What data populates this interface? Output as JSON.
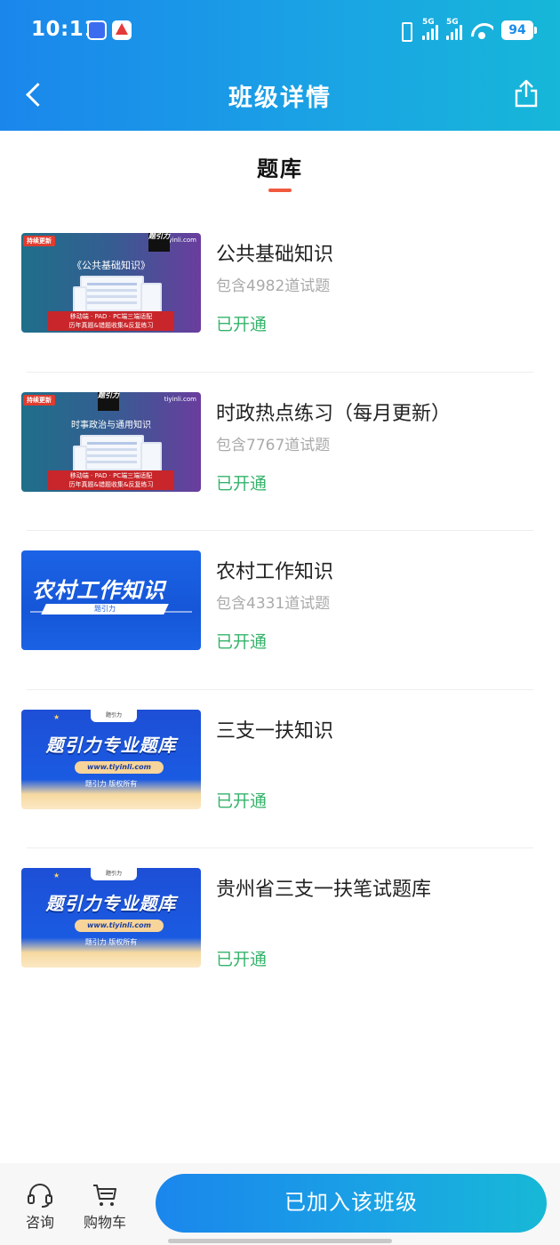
{
  "status_bar": {
    "time": "10:11",
    "battery": "94",
    "network_labels": [
      "5G",
      "5G"
    ]
  },
  "nav": {
    "title": "班级详情"
  },
  "tab": {
    "label": "题库",
    "underline_color": "#f05a3e"
  },
  "items": [
    {
      "title": "公共基础知识",
      "count": "包含4982道试题",
      "status": "已开通",
      "thumb": {
        "badge": "持续更新",
        "site": "tiyinli.com",
        "logo": "题引力",
        "subtitle": "《公共基础知识》",
        "bar_line1": "移动端 · PAD · PC端三端适配",
        "bar_line2": "历年真题&错题收集&反复练习"
      }
    },
    {
      "title": "时政热点练习（每月更新）",
      "count": "包含7767道试题",
      "status": "已开通",
      "thumb": {
        "badge": "持续更新",
        "site": "tiyinli.com",
        "logo": "题引力",
        "subtitle": "时事政治与通用知识",
        "bar_line1": "移动端 · PAD · PC端三端适配",
        "bar_line2": "历年真题&错题收集&反复练习"
      }
    },
    {
      "title": "农村工作知识",
      "count": "包含4331道试题",
      "status": "已开通",
      "thumb": {
        "big": "农村工作知识",
        "pill": "题引力"
      }
    },
    {
      "title": "三支一扶知识",
      "count": "",
      "status": "已开通",
      "thumb": {
        "tab": "题引力",
        "big": "题引力专业题库",
        "url": "www.tiyinli.com",
        "copy": "题引力 版权所有"
      }
    },
    {
      "title": "贵州省三支一扶笔试题库",
      "count": "",
      "status": "已开通",
      "thumb": {
        "tab": "题引力",
        "big": "题引力专业题库",
        "url": "www.tiyinli.com",
        "copy": "题引力 版权所有"
      }
    }
  ],
  "bottom": {
    "consult_label": "咨询",
    "cart_label": "购物车",
    "joined_label": "已加入该班级"
  },
  "colors": {
    "accent_blue": "#1a86ec",
    "status_green": "#35b36b"
  }
}
